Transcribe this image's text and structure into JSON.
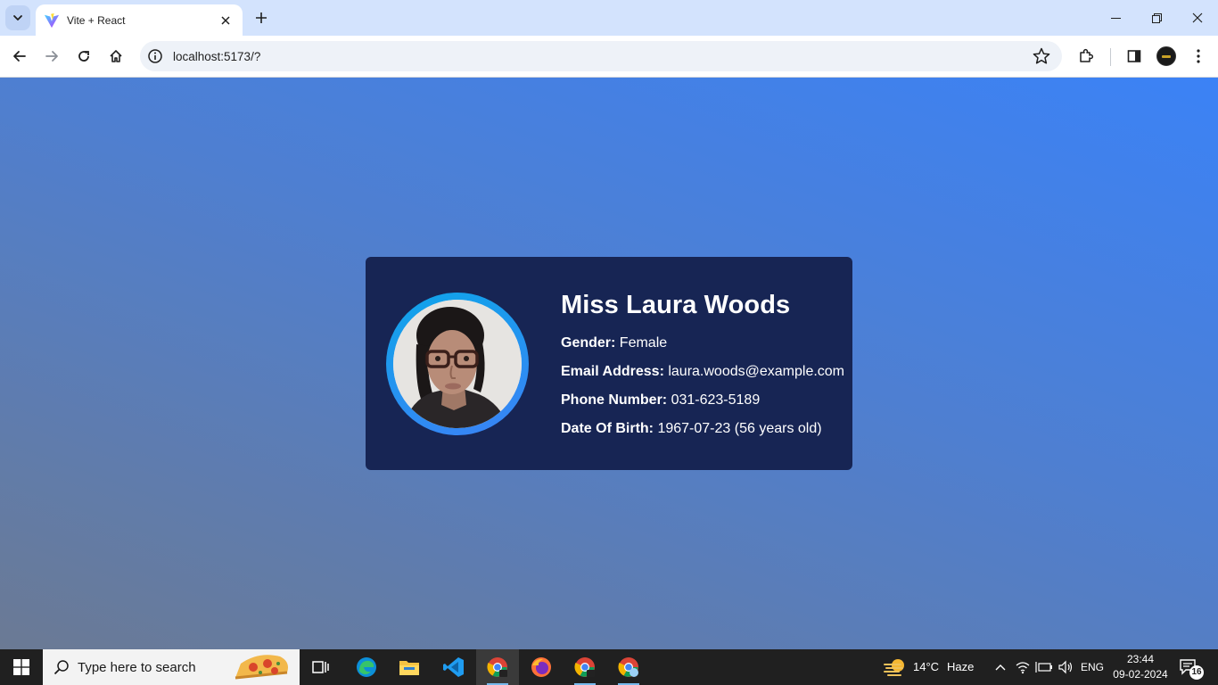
{
  "browser": {
    "tab": {
      "title": "Vite + React",
      "favicon": "vite-logo-icon",
      "close_icon": "close-icon"
    },
    "new_tab_icon": "plus-icon",
    "window_controls": [
      "minimize-icon",
      "restore-icon",
      "close-icon"
    ],
    "toolbar": {
      "back_icon": "arrow-left-icon",
      "forward_icon": "arrow-right-icon",
      "reload_icon": "reload-icon",
      "home_icon": "home-icon",
      "url": "localhost:5173/?",
      "site_info_icon": "info-icon",
      "bookmark_icon": "star-icon",
      "extensions_icon": "puzzle-icon",
      "side_panel_icon": "side-panel-icon",
      "menu_icon": "kebab-menu-icon"
    }
  },
  "profile_card": {
    "name": "Miss Laura Woods",
    "fields": [
      {
        "label": "Gender:",
        "value": "Female"
      },
      {
        "label": "Email Address:",
        "value": "laura.woods@example.com"
      },
      {
        "label": "Phone Number:",
        "value": "031-623-5189"
      },
      {
        "label": "Date Of Birth:",
        "value": "1967-07-23 (56 years old)"
      }
    ],
    "colors": {
      "card_bg": "#172554",
      "ring_from": "#0ea5e9",
      "ring_to": "#3b82f6",
      "page_gradient_top": "#3b82f6",
      "page_gradient_bottom": "#6b7a94"
    }
  },
  "taskbar": {
    "search_placeholder": "Type here to search",
    "apps": [
      "task-view-icon",
      "edge-icon",
      "file-explorer-icon",
      "vscode-icon",
      "chrome-icon",
      "firefox-icon",
      "chrome-icon",
      "chrome-icon"
    ],
    "weather": {
      "temp": "14°C",
      "condition": "Haze"
    },
    "language": "ENG",
    "time": "23:44",
    "date": "09-02-2024",
    "notification_count": "16"
  }
}
